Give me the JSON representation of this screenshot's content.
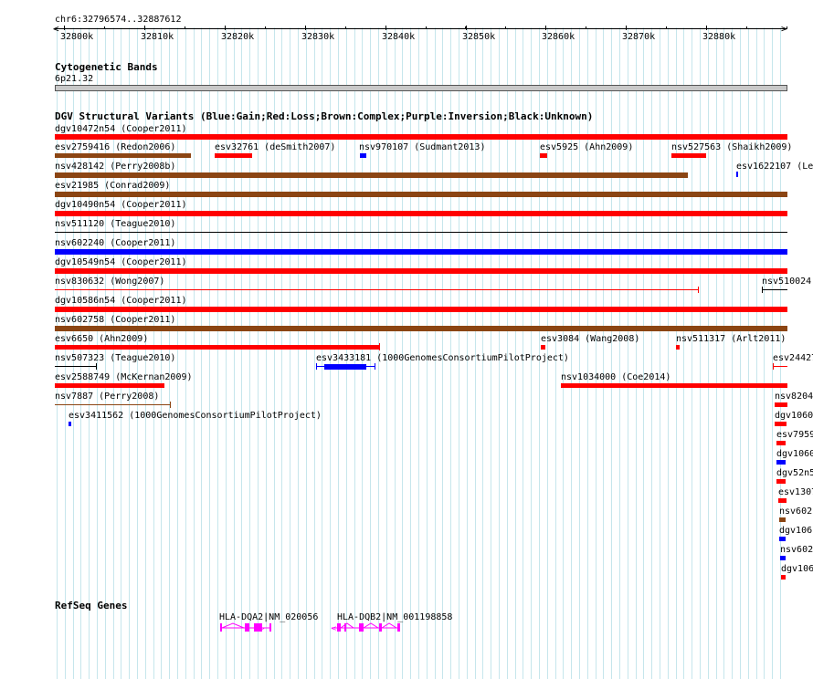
{
  "ruler": {
    "region": "chr6:32796574..32887612",
    "ticks": [
      "32800k",
      "32810k",
      "32820k",
      "32830k",
      "32840k",
      "32850k",
      "32860k",
      "32870k",
      "32880k"
    ]
  },
  "cytobands": {
    "title": "Cytogenetic Bands",
    "band": "6p21.32"
  },
  "dgv": {
    "title": "DGV Structural Variants (Blue:Gain;Red:Loss;Brown:Complex;Purple:Inversion;Black:Unknown)",
    "colors": {
      "gain": "#0000ff",
      "loss": "#ff0000",
      "complex": "#8b4513",
      "unknown": "#000000"
    },
    "features": [
      {
        "label": "dgv10472n54 (Cooper2011)",
        "type": "loss"
      },
      {
        "label": "esv2759416 (Redon2006)",
        "type": "complex"
      },
      {
        "label": "esv32761 (deSmith2007)",
        "type": "loss"
      },
      {
        "label": "nsv970107 (Sudmant2013)",
        "type": "gain"
      },
      {
        "label": "esv5925 (Ahn2009)",
        "type": "loss"
      },
      {
        "label": "nsv527563 (Shaikh2009)",
        "type": "loss"
      },
      {
        "label": "nsv428142 (Perry2008b)",
        "type": "complex"
      },
      {
        "label": "esv1622107 (Le",
        "type": "gain"
      },
      {
        "label": "esv21985 (Conrad2009)",
        "type": "complex"
      },
      {
        "label": "dgv10490n54 (Cooper2011)",
        "type": "loss"
      },
      {
        "label": "nsv511120 (Teague2010)",
        "type": "unknown"
      },
      {
        "label": "nsv602240 (Cooper2011)",
        "type": "gain"
      },
      {
        "label": "dgv10549n54 (Cooper2011)",
        "type": "loss"
      },
      {
        "label": "nsv830632 (Wong2007)",
        "type": "loss"
      },
      {
        "label": "nsv510024",
        "type": "unknown"
      },
      {
        "label": "dgv10586n54 (Cooper2011)",
        "type": "loss"
      },
      {
        "label": "nsv602758 (Cooper2011)",
        "type": "complex"
      },
      {
        "label": "esv6650 (Ahn2009)",
        "type": "loss"
      },
      {
        "label": "esv3084 (Wang2008)",
        "type": "loss"
      },
      {
        "label": "nsv511317 (Arlt2011)",
        "type": "loss"
      },
      {
        "label": "nsv507323 (Teague2010)",
        "type": "unknown"
      },
      {
        "label": "esv3433181 (1000GenomesConsortiumPilotProject)",
        "type": "gain"
      },
      {
        "label": "esv24427",
        "type": "loss"
      },
      {
        "label": "esv2588749 (McKernan2009)",
        "type": "loss"
      },
      {
        "label": "nsv1034000 (Coe2014)",
        "type": "loss"
      },
      {
        "label": "nsv7887 (Perry2008)",
        "type": "complex"
      },
      {
        "label": "nsv8204",
        "type": "loss"
      },
      {
        "label": "esv3411562 (1000GenomesConsortiumPilotProject)",
        "type": "gain"
      },
      {
        "label": "dgv1060",
        "type": "loss"
      },
      {
        "label": "esv7959",
        "type": "loss"
      },
      {
        "label": "dgv1060",
        "type": "gain"
      },
      {
        "label": "dgv52n5",
        "type": "loss"
      },
      {
        "label": "esv1307",
        "type": "loss"
      },
      {
        "label": "nsv602",
        "type": "complex"
      },
      {
        "label": "dgv106",
        "type": "gain"
      },
      {
        "label": "nsv602",
        "type": "gain"
      },
      {
        "label": "dgv106",
        "type": "loss"
      }
    ]
  },
  "refseq": {
    "title": "RefSeq Genes",
    "color": "#ff00ff",
    "genes": [
      {
        "label": "HLA-DQA2|NM_020056"
      },
      {
        "label": "HLA-DQB2|NM_001198858"
      }
    ]
  }
}
